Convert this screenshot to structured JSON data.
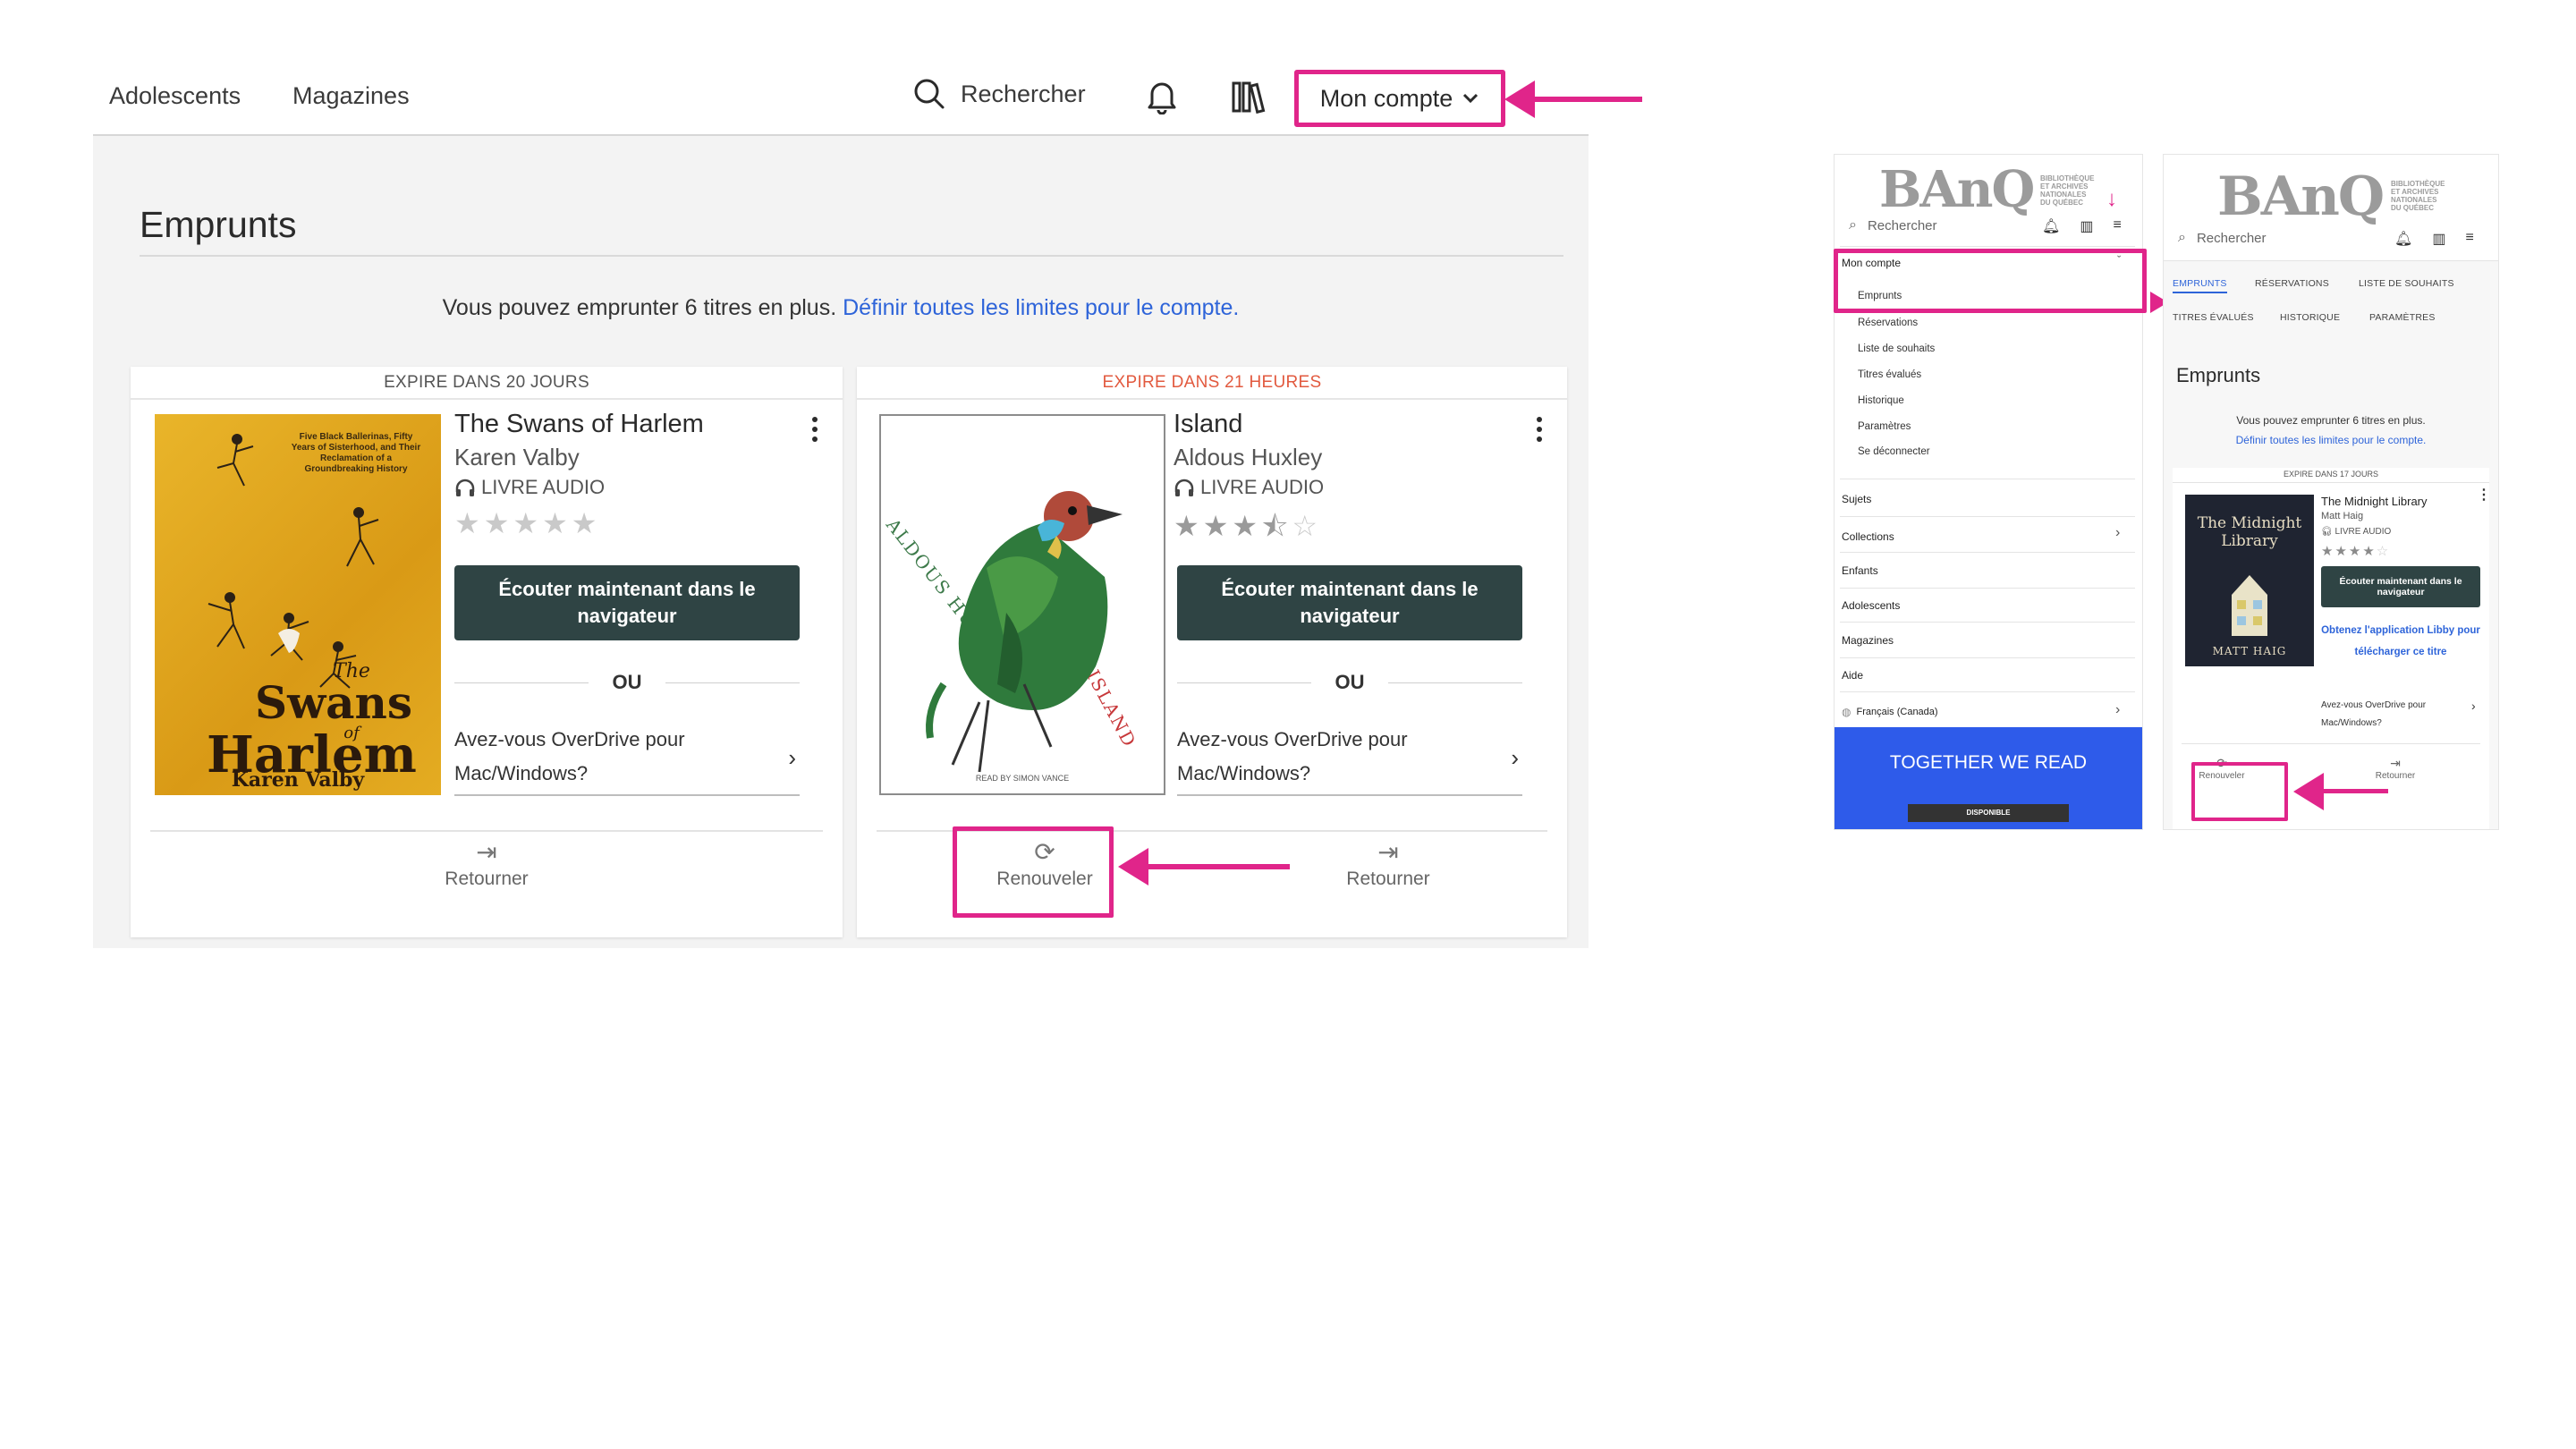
{
  "desktop": {
    "nav": {
      "teens": "Adolescents",
      "magazines": "Magazines",
      "search": "Rechercher",
      "account": "Mon compte"
    },
    "page_title": "Emprunts",
    "info_text": "Vous pouvez emprunter 6 titres en plus.",
    "info_link": "Définir toutes les limites pour le compte.",
    "loans": [
      {
        "expire": "EXPIRE DANS 20 JOURS",
        "title": "The Swans of Harlem",
        "author": "Karen Valby",
        "format": "LIVRE AUDIO",
        "rating": 0,
        "listen": "Écouter maintenant dans le navigateur",
        "or": "OU",
        "overdrive": "Avez-vous OverDrive pour Mac/Windows?",
        "cover_tagline": "Five Black Ballerinas, Fifty Years of Sisterhood, and Their Reclamation of a Groundbreaking History",
        "cover_title_1": "The",
        "cover_title_2": "Swans",
        "cover_title_3": "of",
        "cover_title_4": "Harlem",
        "cover_author": "Karen Valby",
        "return": "Retourner"
      },
      {
        "expire": "EXPIRE DANS 21 HEURES",
        "title": "Island",
        "author": "Aldous Huxley",
        "format": "LIVRE AUDIO",
        "rating": 3.5,
        "listen": "Écouter maintenant dans le navigateur",
        "or": "OU",
        "overdrive": "Avez-vous OverDrive pour Mac/Windows?",
        "cover_author": "ALDOUS HUXLEY",
        "cover_title": "ISLAND",
        "cover_reader": "READ BY SIMON VANCE",
        "renew": "Renouveler",
        "return": "Retourner"
      }
    ]
  },
  "mobile_menu": {
    "logo": "BAnQ",
    "logo_sub": [
      "BIBLIOTHÈQUE",
      "ET ARCHIVES",
      "NATIONALES",
      "DU QUÉBEC"
    ],
    "search": "Rechercher",
    "account": "Mon compte",
    "account_items": [
      "Emprunts",
      "Réservations",
      "Liste de souhaits",
      "Titres évalués",
      "Historique",
      "Paramètres",
      "Se déconnecter"
    ],
    "items": [
      "Sujets",
      "Collections",
      "Enfants",
      "Adolescents",
      "Magazines",
      "Aide"
    ],
    "language": "Français (Canada)",
    "banner_title": "TOGETHER WE READ",
    "banner_badge": "DISPONIBLE"
  },
  "mobile_loans": {
    "logo": "BAnQ",
    "logo_sub": [
      "BIBLIOTHÈQUE",
      "ET ARCHIVES",
      "NATIONALES",
      "DU QUÉBEC"
    ],
    "search": "Rechercher",
    "tabs_row1": [
      "EMPRUNTS",
      "RÉSERVATIONS",
      "LISTE DE SOUHAITS"
    ],
    "tabs_row2": [
      "TITRES ÉVALUÉS",
      "HISTORIQUE",
      "PARAMÈTRES"
    ],
    "page_title": "Emprunts",
    "info_text": "Vous pouvez emprunter 6 titres en plus.",
    "info_link": "Définir toutes les limites pour le compte.",
    "expire": "EXPIRE DANS 17 JOURS",
    "title": "The Midnight Library",
    "author": "Matt Haig",
    "format": "LIVRE AUDIO",
    "rating": 4,
    "listen": "Écouter maintenant dans le navigateur",
    "get_app": "Obtenez l'application Libby pour télécharger ce titre",
    "overdrive": "Avez-vous OverDrive pour Mac/Windows?",
    "cover_title": "The Midnight Library",
    "cover_author": "MATT HAIG",
    "renew": "Renouveler",
    "return": "Retourner"
  },
  "colors": {
    "highlight": "#e0258a",
    "link": "#2e64d9",
    "button": "#2f4444",
    "expire_urgent": "#e25a3f",
    "banner": "#2e5bea"
  }
}
